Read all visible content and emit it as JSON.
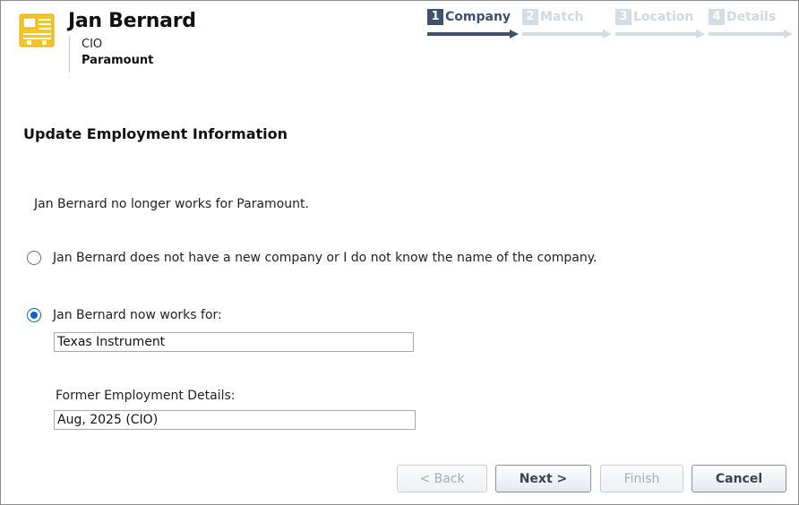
{
  "header": {
    "name": "Jan Bernard",
    "job_title": "CIO",
    "company": "Paramount"
  },
  "wizard": {
    "steps": [
      {
        "number": "1",
        "label": "Company",
        "state": "active"
      },
      {
        "number": "2",
        "label": "Match",
        "state": "inactive"
      },
      {
        "number": "3",
        "label": "Location",
        "state": "inactive"
      },
      {
        "number": "4",
        "label": "Details",
        "state": "inactive"
      }
    ]
  },
  "main": {
    "section_title": "Update Employment Information",
    "info_text": "Jan Bernard no longer works for Paramount.",
    "option_no_company": {
      "label": "Jan Bernard does not have a new company or I do not know the name of the company.",
      "checked": false
    },
    "option_new_company": {
      "label": "Jan Bernard now works for:",
      "checked": true,
      "value": "Texas Instrument"
    },
    "former_details": {
      "label": "Former Employment Details:",
      "value": "Aug, 2025 (CIO)"
    }
  },
  "buttons": {
    "back": "< Back",
    "next": "Next >",
    "finish": "Finish",
    "cancel": "Cancel"
  },
  "colors": {
    "step_active": "#3e526e",
    "step_inactive": "#d4dce6",
    "radio_selected": "#0a64c8",
    "icon_yellow": "#f5c526"
  }
}
